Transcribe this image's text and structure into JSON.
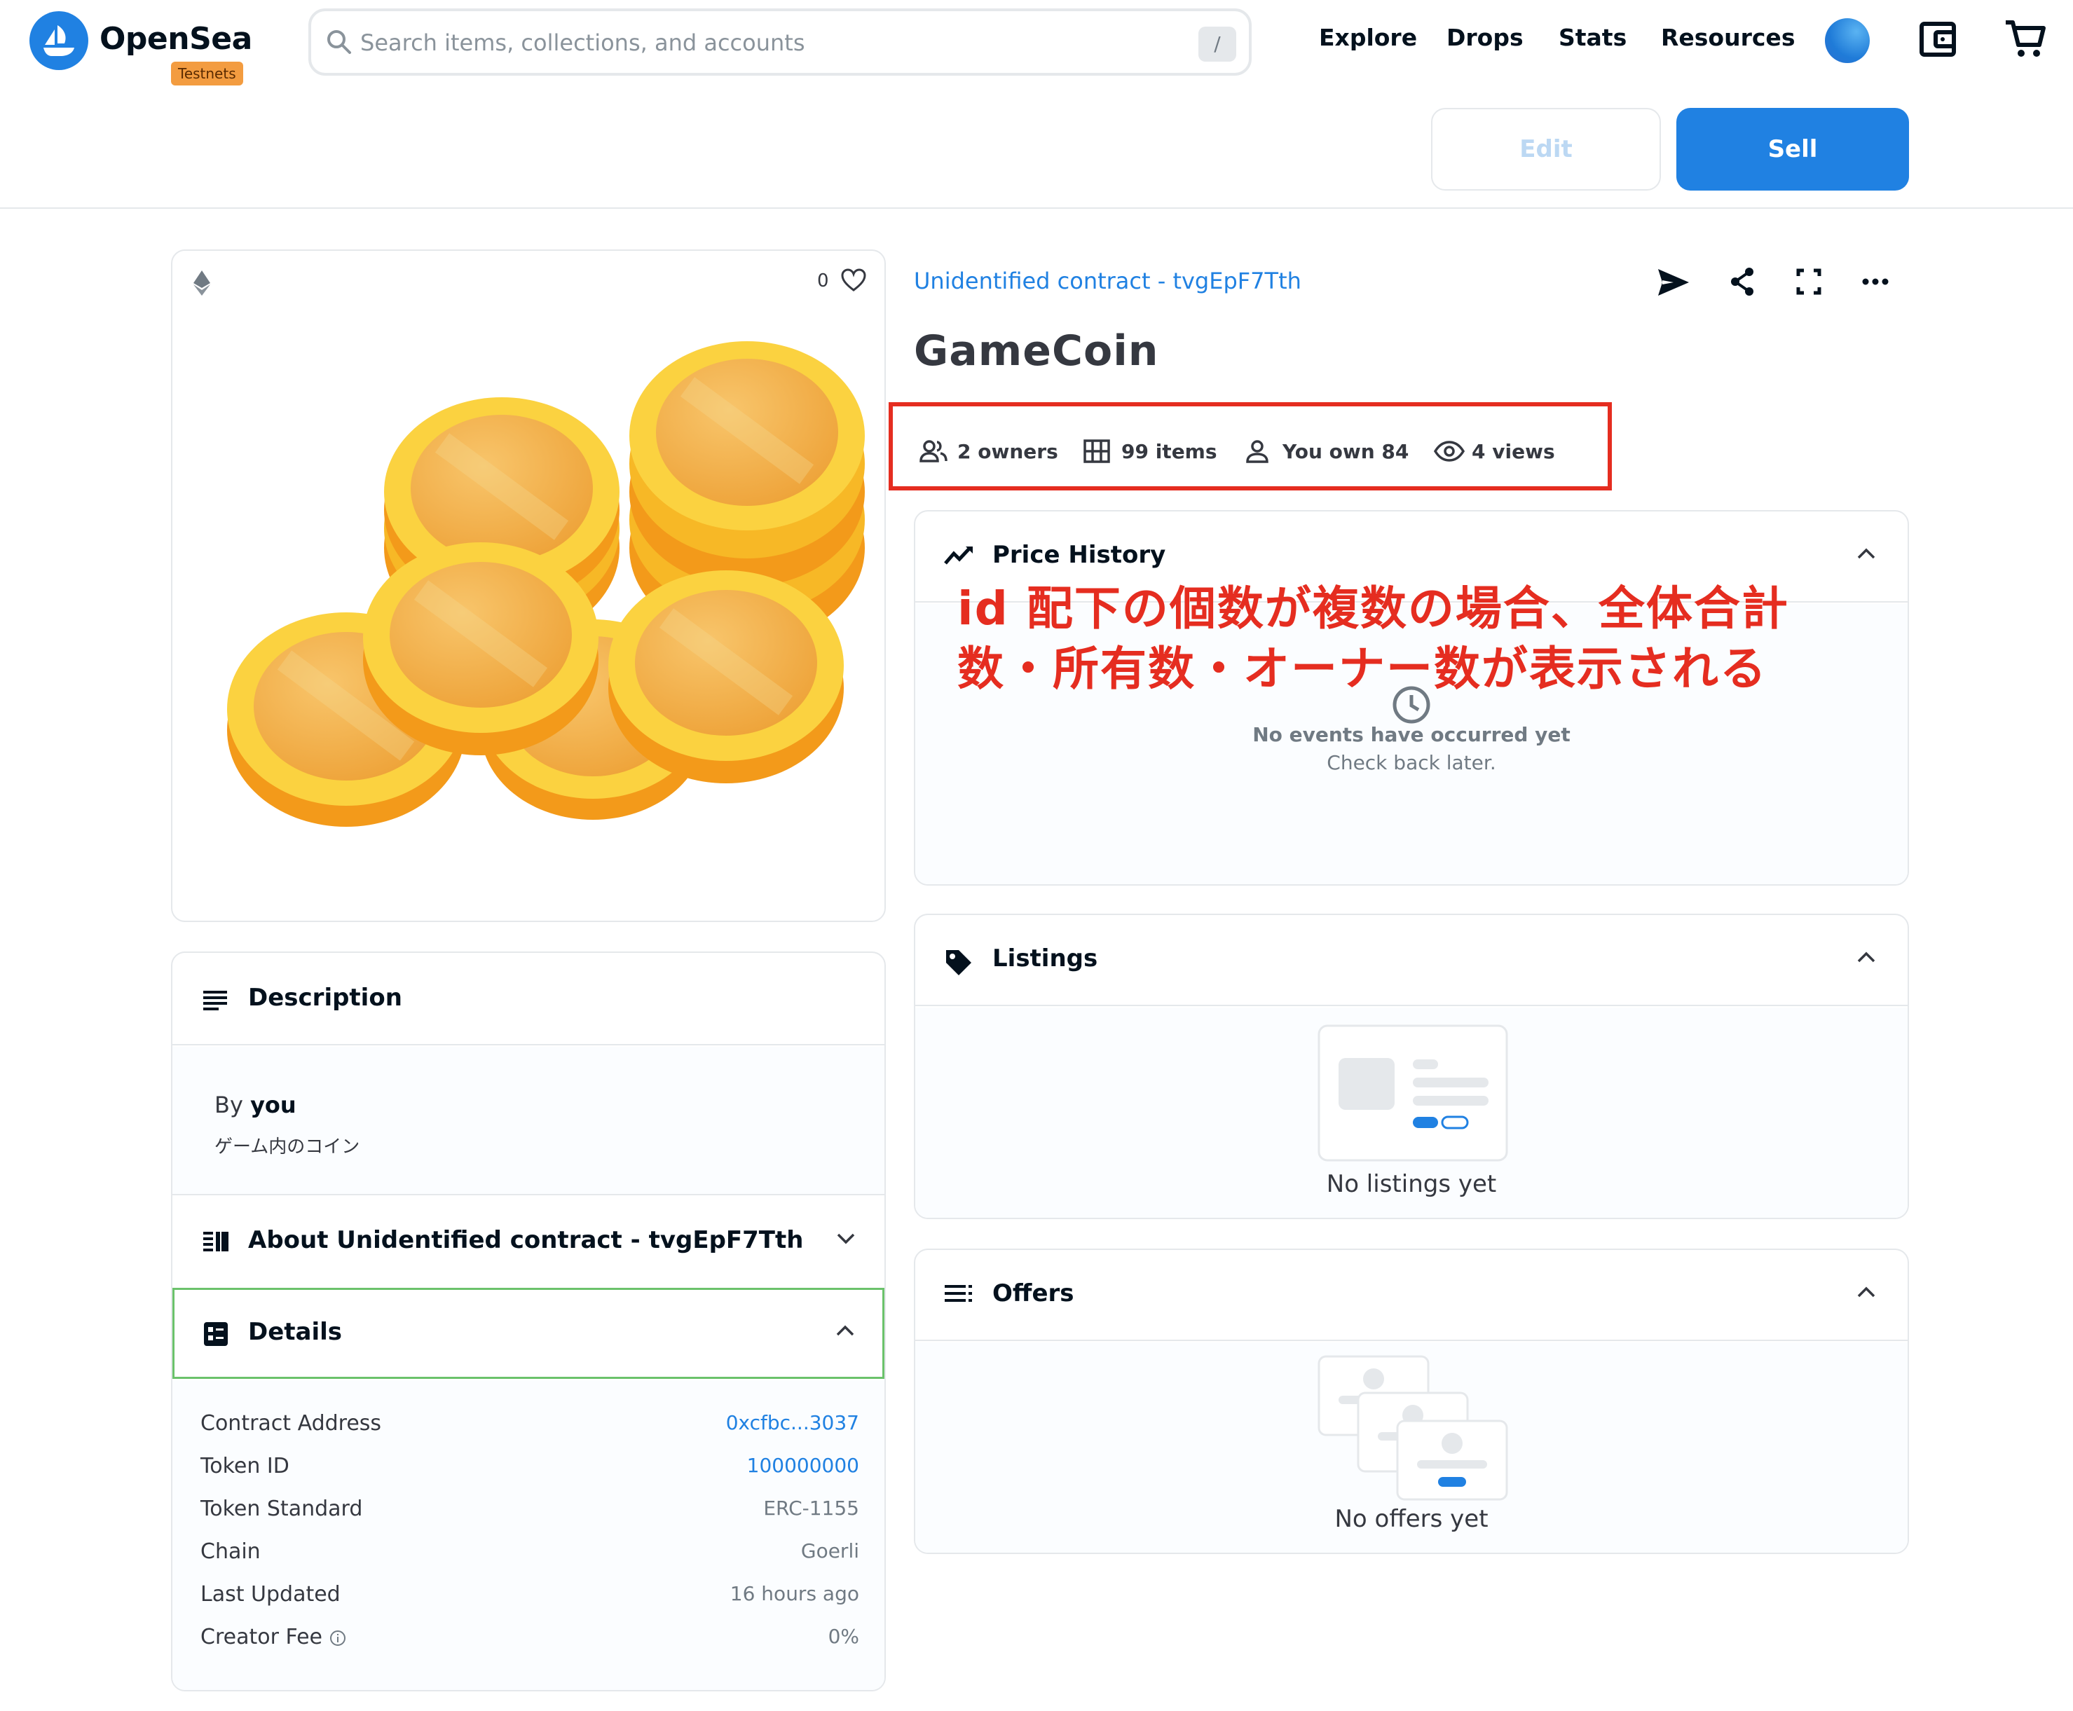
{
  "header": {
    "brand": "OpenSea",
    "badge": "Testnets",
    "search_placeholder": "Search items, collections, and accounts",
    "search_shortcut": "/",
    "nav": [
      "Explore",
      "Drops",
      "Stats",
      "Resources"
    ],
    "edit_label": "Edit",
    "sell_label": "Sell",
    "accent_color": "#2081e2"
  },
  "media": {
    "favorites": "0"
  },
  "item": {
    "contract": "Unidentified contract - tvgEpF7Tth",
    "title": "GameCoin",
    "stats": {
      "owners": "2 owners",
      "items": "99 items",
      "own": "You own 84",
      "views": "4 views"
    }
  },
  "description": {
    "heading": "Description",
    "by_prefix": "By",
    "by_user": "you",
    "text": "ゲーム内のコイン"
  },
  "about": {
    "heading": "About Unidentified contract - tvgEpF7Tth"
  },
  "details": {
    "heading": "Details",
    "rows": [
      {
        "key": "Contract Address",
        "value": "0xcfbc...3037"
      },
      {
        "key": "Token ID",
        "value": "100000000"
      },
      {
        "key": "Token Standard",
        "value": "ERC-1155"
      },
      {
        "key": "Chain",
        "value": "Goerli"
      },
      {
        "key": "Last Updated",
        "value": "16 hours ago"
      },
      {
        "key": "Creator Fee",
        "value": "0%"
      }
    ]
  },
  "price_history": {
    "heading": "Price History",
    "empty_title": "No events have occurred yet",
    "empty_sub": "Check back later."
  },
  "annotation": {
    "line1": "id 配下の個数が複数の場合、全体合計",
    "line2": "数・所有数・オーナー数が表示される",
    "color": "#e52d20"
  },
  "listings": {
    "heading": "Listings",
    "empty": "No listings yet"
  },
  "offers": {
    "heading": "Offers",
    "empty": "No offers yet"
  }
}
